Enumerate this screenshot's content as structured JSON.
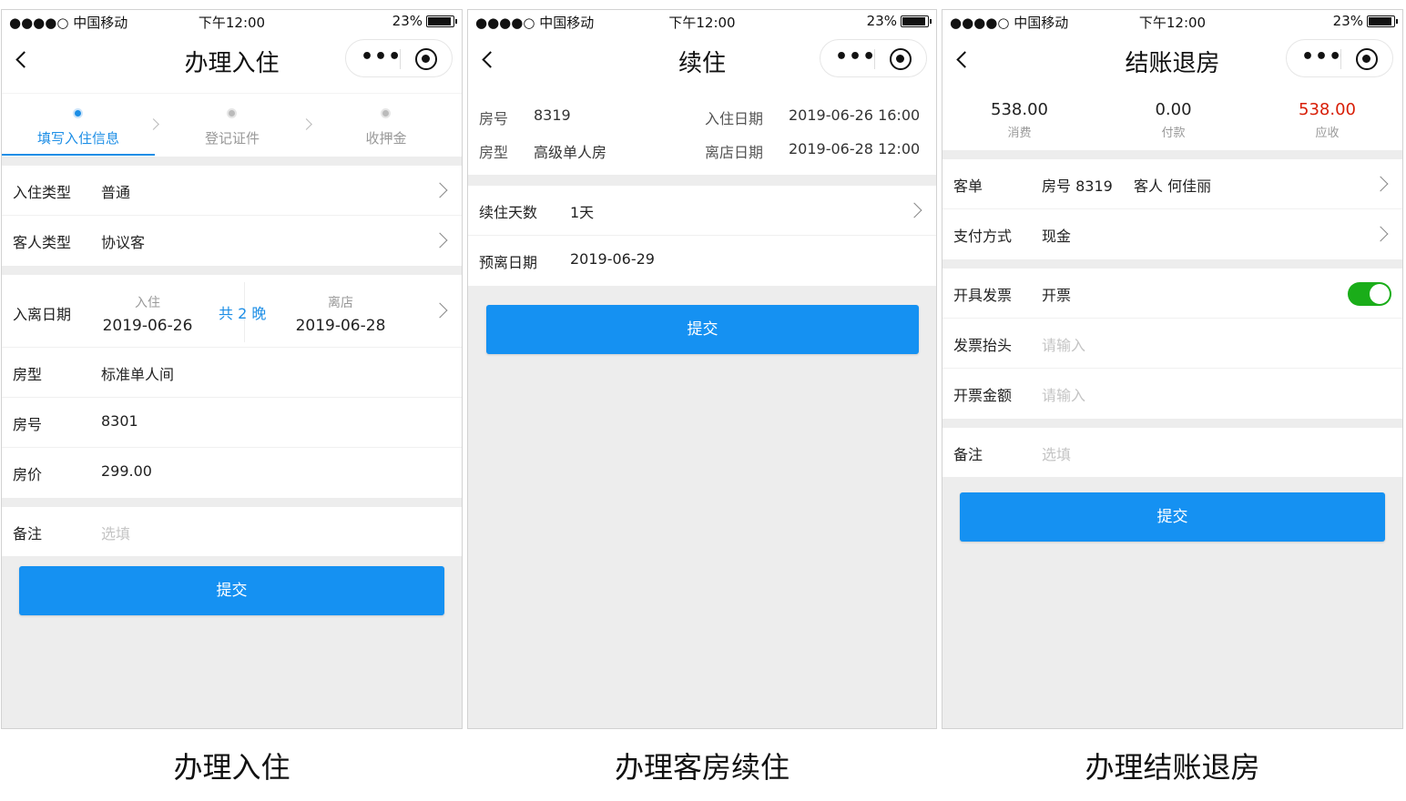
{
  "status": {
    "signal": "●●●●○ 中国移动",
    "time": "下午12:00",
    "battery": "23%"
  },
  "checkin": {
    "title": "办理入住",
    "steps": [
      "填写入住信息",
      "登记证件",
      "收押金"
    ],
    "stay_type_label": "入住类型",
    "stay_type_value": "普通",
    "guest_type_label": "客人类型",
    "guest_type_value": "协议客",
    "dates_label": "入离日期",
    "checkin_small": "入住",
    "checkin_date": "2019-06-26",
    "nights": "共 2 晚",
    "checkout_small": "离店",
    "checkout_date": "2019-06-28",
    "room_type_label": "房型",
    "room_type_value": "标准单人间",
    "room_no_label": "房号",
    "room_no_value": "8301",
    "price_label": "房价",
    "price_value": "299.00",
    "remark_label": "备注",
    "remark_placeholder": "选填",
    "submit": "提交"
  },
  "extend": {
    "title": "续住",
    "room_no_label": "房号",
    "room_no_value": "8319",
    "checkin_label": "入住日期",
    "checkin_value": "2019-06-26 16:00",
    "room_type_label": "房型",
    "room_type_value": "高级单人房",
    "checkout_label": "离店日期",
    "checkout_value": "2019-06-28 12:00",
    "days_label": "续住天数",
    "days_value": "1天",
    "depart_label": "预离日期",
    "depart_value": "2019-06-29",
    "submit": "提交"
  },
  "checkout": {
    "title": "结账退房",
    "consume_value": "538.00",
    "consume_label": "消费",
    "paid_value": "0.00",
    "paid_label": "付款",
    "due_value": "538.00",
    "due_label": "应收",
    "bill_label": "客单",
    "bill_room": "房号 8319",
    "bill_guest": "客人 何佳丽",
    "pay_label": "支付方式",
    "pay_value": "现金",
    "invoice_label": "开具发票",
    "invoice_value": "开票",
    "header_label": "发票抬头",
    "header_placeholder": "请输入",
    "amount_label": "开票金额",
    "amount_placeholder": "请输入",
    "remark_label": "备注",
    "remark_placeholder": "选填",
    "submit": "提交"
  },
  "captions": [
    "办理入住",
    "办理客房续住",
    "办理结账退房"
  ],
  "colors": {
    "accent": "#1591f2",
    "due": "#d81e06",
    "switch_on": "#1aad19"
  }
}
